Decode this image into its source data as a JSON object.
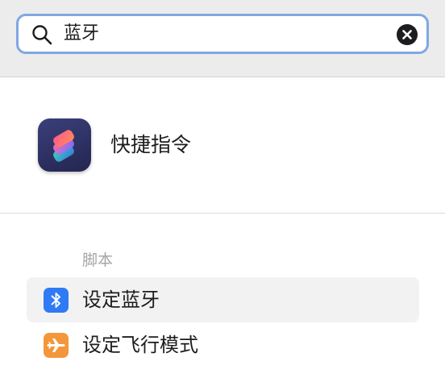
{
  "search": {
    "value": "蓝牙",
    "icon": "search-icon",
    "clear_icon": "close-circle-icon"
  },
  "app_result": {
    "name": "快捷指令",
    "icon": "shortcuts-app-icon"
  },
  "scripts_section": {
    "header": "脚本",
    "items": [
      {
        "label": "设定蓝牙",
        "icon": "bluetooth-icon",
        "icon_color": "#2f7af5",
        "selected": true
      },
      {
        "label": "设定飞行模式",
        "icon": "airplane-icon",
        "icon_color": "#f4963a",
        "selected": false
      }
    ]
  },
  "colors": {
    "search_focus_ring": "#80a7e3",
    "selection_background": "#f2f2f2"
  }
}
